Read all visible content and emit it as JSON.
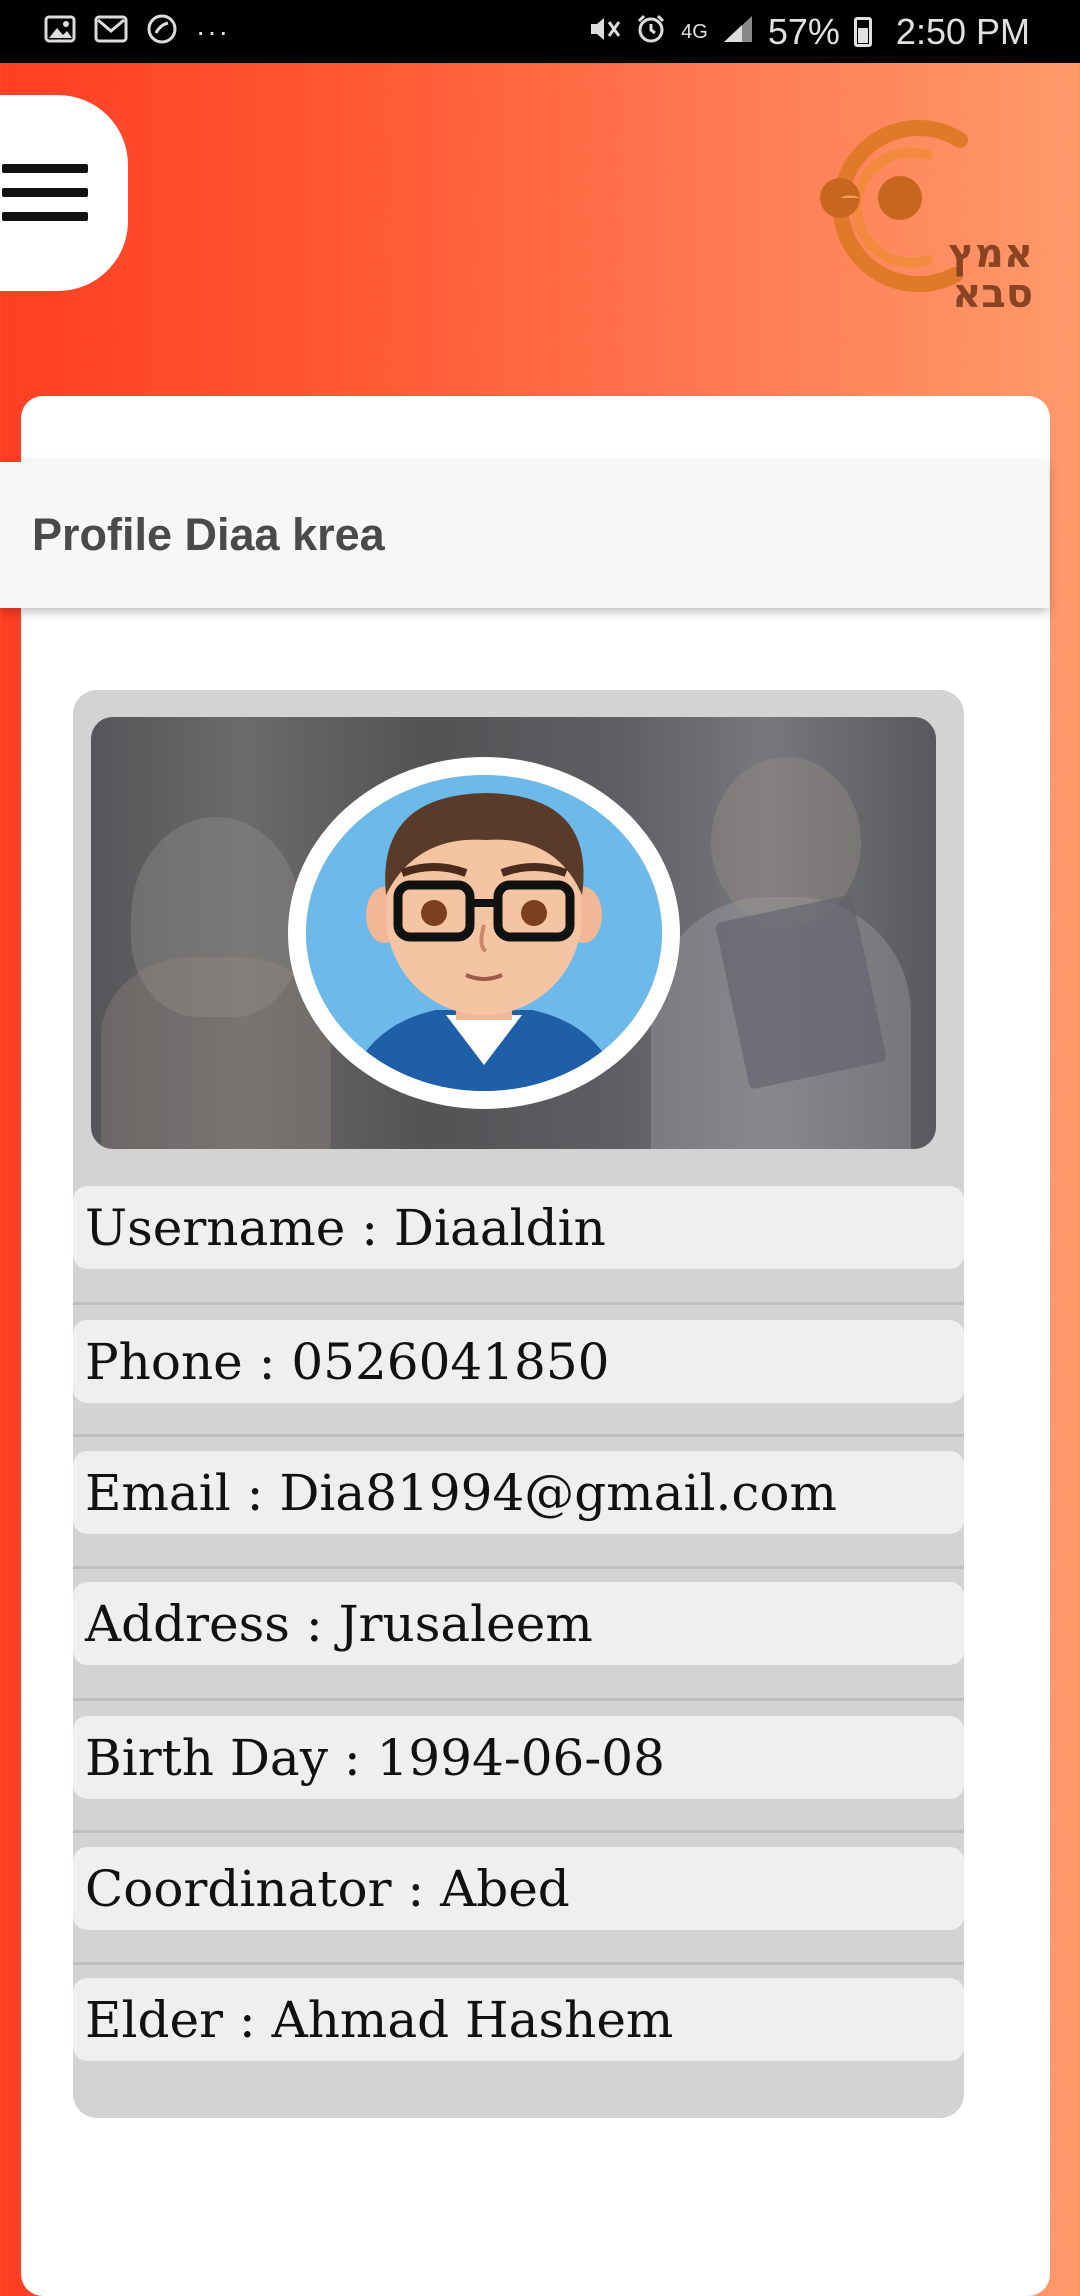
{
  "status_bar": {
    "icons_left": [
      "image-icon",
      "gmail-icon",
      "missed-call-icon",
      "more-icon"
    ],
    "more": "···",
    "icons_right": [
      "mute-icon",
      "alarm-icon",
      "network-4g-icon",
      "signal-icon",
      "battery-icon"
    ],
    "network": "4G",
    "battery": "57%",
    "time": "2:50 PM"
  },
  "header": {
    "menu_icon": "hamburger-icon",
    "logo_text": "אמץ סבא",
    "logo_color": "#e07020"
  },
  "page": {
    "title": "Profile Diaa krea"
  },
  "profile": {
    "fields": [
      {
        "text": "Username : Diaaldin"
      },
      {
        "text": "Phone : 0526041850"
      },
      {
        "text": "Email : Dia81994@gmail.com"
      },
      {
        "text": "Address : Jrusaleem"
      },
      {
        "text": "Birth Day : 1994-06-08"
      },
      {
        "text": "Coordinator : Abed"
      },
      {
        "text": "Elder : Ahmad Hashem"
      }
    ]
  },
  "colors": {
    "background_start": "#ff3e24",
    "background_end": "#ff9a6b",
    "title_bar": "#f7f7f7",
    "card": "#d4d3d3",
    "row": "#f0eeee"
  }
}
